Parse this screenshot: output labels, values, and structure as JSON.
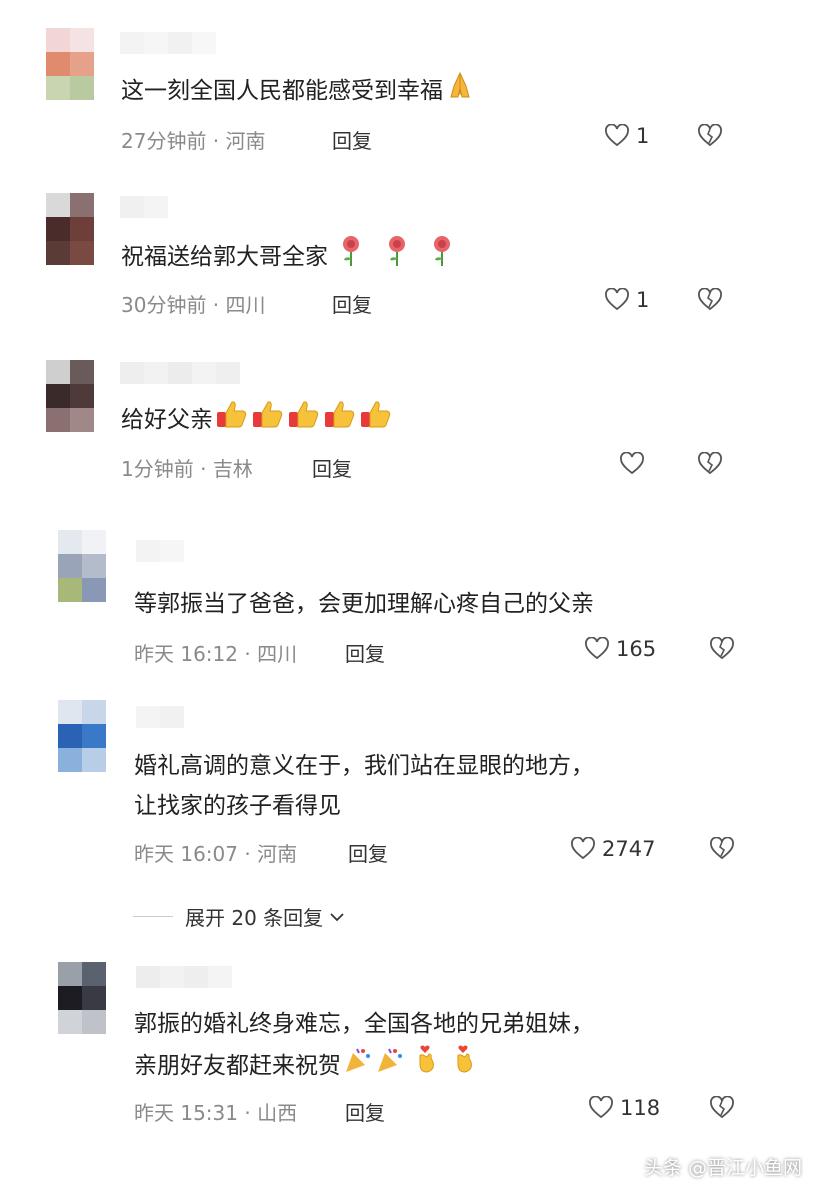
{
  "colors": {
    "meta": "#8a8a8a",
    "text": "#222222",
    "icon_stroke": "#555555"
  },
  "comments": [
    {
      "text": "这一刻全国人民都能感受到幸福",
      "emoji": "pray-icon",
      "time": "27分钟前",
      "location": "河南",
      "reply": "回复",
      "likes": "1"
    },
    {
      "text": "祝福送给郭大哥全家",
      "emoji": "rose-icon",
      "time": "30分钟前",
      "location": "四川",
      "reply": "回复",
      "likes": "1"
    },
    {
      "text": "给好父亲",
      "emoji": "thumbs-up-icon",
      "time": "1分钟前",
      "location": "吉林",
      "reply": "回复",
      "likes": ""
    },
    {
      "text": "等郭振当了爸爸，会更加理解心疼自己的父亲",
      "time": "昨天 16:12",
      "location": "四川",
      "reply": "回复",
      "likes": "165"
    },
    {
      "text_line1": "婚礼高调的意义在于，我们站在显眼的地方，",
      "text_line2": "让找家的孩子看得见",
      "time": "昨天 16:07",
      "location": "河南",
      "reply": "回复",
      "likes": "2747"
    },
    {
      "text_line1": "郭振的婚礼终身难忘，全国各地的兄弟姐妹，",
      "text_line2": "亲朋好友都赶来祝贺",
      "emoji": "party-popper-icon",
      "time": "昨天 15:31",
      "location": "山西",
      "reply": "回复",
      "likes": "118"
    }
  ],
  "expand_replies": "展开 20 条回复",
  "watermark": "头条 @晋江小鱼网"
}
